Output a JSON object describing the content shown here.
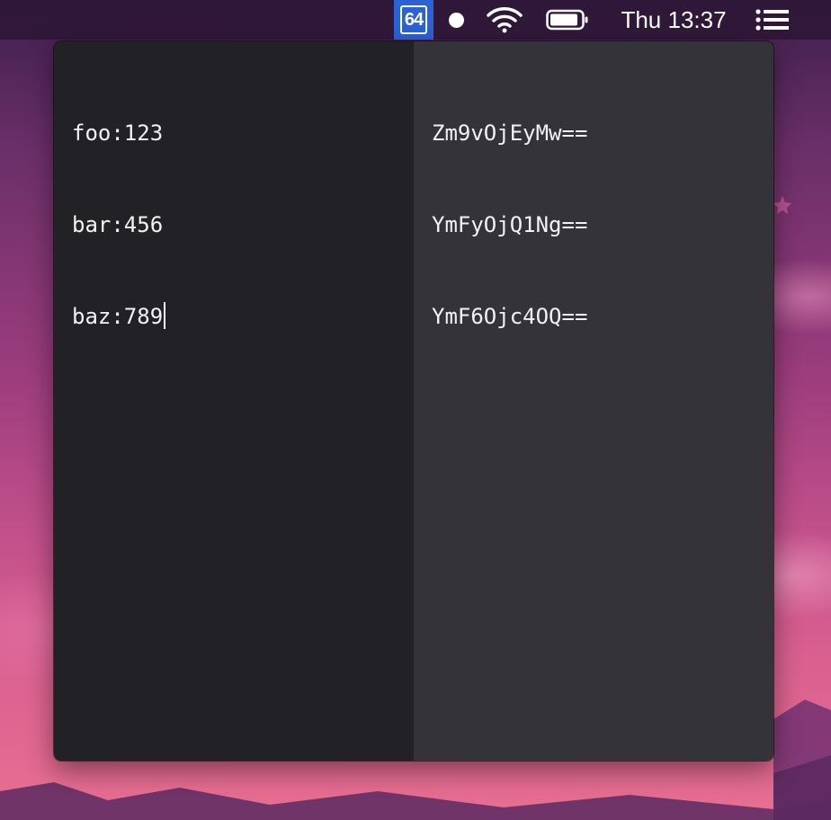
{
  "menubar": {
    "app_icon_label": "64",
    "app_icon_name": "base64-app-icon",
    "clock": "Thu 13:37",
    "icons": [
      "record-dot-icon",
      "wifi-icon",
      "battery-icon",
      "list-menu-icon"
    ]
  },
  "editor": {
    "input_lines": [
      "foo:123",
      "bar:456",
      "baz:789"
    ],
    "output_lines": [
      "Zm9vOjEyMw==",
      "YmFyOjQ1Ng==",
      "YmF6Ojc4OQ=="
    ]
  },
  "colors": {
    "input_bg": "#222226",
    "output_bg": "#333339",
    "app_icon_bg": "#2c62d8",
    "text": "#f2f2f2"
  }
}
